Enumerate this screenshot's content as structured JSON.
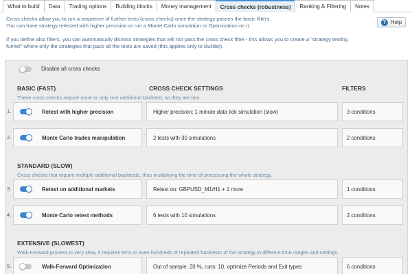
{
  "tabs": [
    {
      "label": "What to build",
      "active": false
    },
    {
      "label": "Data",
      "active": false
    },
    {
      "label": "Trading options",
      "active": false
    },
    {
      "label": "Building blocks",
      "active": false
    },
    {
      "label": "Money management",
      "active": false
    },
    {
      "label": "Cross checks (robustness)",
      "active": true
    },
    {
      "label": "Ranking & Filtering",
      "active": false
    },
    {
      "label": "Notes",
      "active": false
    }
  ],
  "intro": {
    "line1": "Cross checks allow you to run a sequence of further tests (cross checks) once the strategy passes the basic filters.",
    "line2": "You can have strategy retested with higher precision or run a Monte Carlo simulation or Optimization on it.",
    "line3": "If you define also filters, you can automatically dismiss strategies that will not pass the cross check filter - this allows you to create a \"strategy testing",
    "line4": "funnel\" where only the strategies that pass all the tests are saved (this applies only to Builder)."
  },
  "help": {
    "label": "Help",
    "icon": "question-circle-icon",
    "glyph": "?"
  },
  "disable_all": {
    "label": "Disable all cross checks",
    "enabled": false
  },
  "columns": {
    "settings": "CROSS CHECK SETTINGS",
    "filters": "FILTERS"
  },
  "colors": {
    "accent": "#3a86d6",
    "toggle_off": "#c8c8c8",
    "active_tab": "#e9f0f7"
  },
  "sections": [
    {
      "title": "BASIC (FAST)",
      "description": "These cross checks require none or only one additional backtest, so they are fast.",
      "rows": [
        {
          "num": "1.",
          "name": "Retest with higher precision",
          "enabled": true,
          "settings": "Higher precision: 1 minute data tick simulation (slow)",
          "filters": "3 conditions"
        },
        {
          "num": "2.",
          "name": "Monte Carlo trades manipulation",
          "enabled": true,
          "settings": "2 tests with 30 simulations",
          "filters": "2 conditions"
        }
      ]
    },
    {
      "title": "STANDARD (SLOW)",
      "description": "Cross checks that require multiple additional backtests, thus multiplying the time of processing the whole strategy.",
      "rows": [
        {
          "num": "3.",
          "name": "Retest on additional markets",
          "enabled": true,
          "settings": "Retest on: GBPUSD_M1/H1 + 1 more",
          "filters": "1 conditions"
        },
        {
          "num": "4.",
          "name": "Monte Carlo retest methods",
          "enabled": true,
          "settings": "6 tests with 10 simulations",
          "filters": "2 conditions"
        }
      ]
    },
    {
      "title": "EXTENSIVE (SLOWEST)",
      "description": "Walk-Forward process is very slow, it requires tens or even hundreds of repeated backtests of the strategy in different time ranges and settings.",
      "rows": [
        {
          "num": "5.",
          "name": "Walk-Forward Optimization",
          "enabled": false,
          "settings": "Out of sample: 20 %, runs: 10, optimize Periods and Exit types",
          "filters": "6 conditions"
        }
      ]
    }
  ]
}
